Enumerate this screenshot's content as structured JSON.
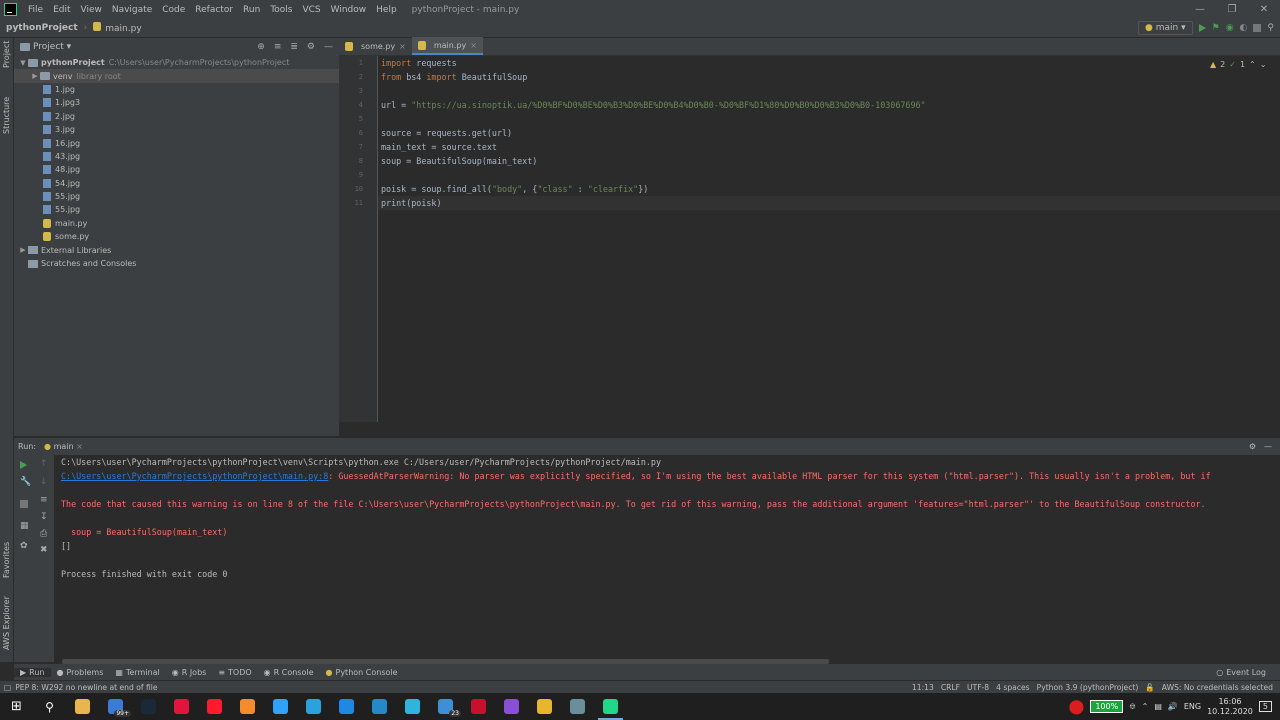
{
  "titlebar": {
    "menu": [
      "File",
      "Edit",
      "View",
      "Navigate",
      "Code",
      "Refactor",
      "Run",
      "Tools",
      "VCS",
      "Window",
      "Help"
    ],
    "window_title": "pythonProject - main.py"
  },
  "navbar": {
    "project": "pythonProject",
    "file": "main.py",
    "run_config": "main",
    "build_icon": "hammer-icon"
  },
  "sidebar": {
    "project_tab": "Project",
    "structure_tab": "Structure",
    "favorites_tab": "Favorites",
    "aws_tab": "AWS Explorer"
  },
  "project_panel": {
    "title": "Project",
    "root": {
      "name": "pythonProject",
      "path": "C:\\Users\\user\\PycharmProjects\\pythonProject"
    },
    "venv": {
      "name": "venv",
      "note": "library root"
    },
    "files": [
      "1.jpg",
      "1.jpg3",
      "2.jpg",
      "3.jpg",
      "16.jpg",
      "43.jpg",
      "48.jpg",
      "54.jpg",
      "55.jpg",
      "55.jpg"
    ],
    "py_files": [
      "main.py",
      "some.py"
    ],
    "external": "External Libraries",
    "scratches": "Scratches and Consoles"
  },
  "editor": {
    "tabs": [
      {
        "label": "some.py",
        "active": false
      },
      {
        "label": "main.py",
        "active": true
      }
    ],
    "line_numbers": [
      "1",
      "2",
      "3",
      "4",
      "5",
      "6",
      "7",
      "8",
      "9",
      "10",
      "11"
    ],
    "code": {
      "l1_kw": "import",
      "l1_rest": " requests",
      "l2_kw1": "from",
      "l2_mid": " bs4 ",
      "l2_kw2": "import",
      "l2_rest": " BeautifulSoup",
      "l4_pre": "url = ",
      "l4_url": "\"https://ua.sinoptik.ua/%D0%BF%D0%BE%D0%B3%D0%BE%D0%B4%D0%B0-%D0%BF%D1%80%D0%B0%D0%B3%D0%B0-103067696\"",
      "l6": "source = requests.get(url)",
      "l7": "main_text = source.text",
      "l8": "soup = BeautifulSoup(main_text)",
      "l10_pre": "poisk = soup.find_all(",
      "l10_s1": "\"body\"",
      "l10_mid": ", {",
      "l10_s2": "\"class\"",
      "l10_colon": " : ",
      "l10_s3": "\"clearfix\"",
      "l10_end": "})",
      "l11": "print(poisk)"
    },
    "inspections": {
      "warnings": "2",
      "ok": "1"
    }
  },
  "run_panel": {
    "label": "Run:",
    "tab": "main",
    "lines": {
      "cmd": "C:\\Users\\user\\PycharmProjects\\pythonProject\\venv\\Scripts\\python.exe C:/Users/user/PycharmProjects/pythonProject/main.py",
      "warn_link": "C:\\Users\\user\\PycharmProjects\\pythonProject\\main.py:8",
      "warn_text": ": GuessedAtParserWarning: No parser was explicitly specified, so I'm using the best available HTML parser for this system (\"html.parser\"). This usually isn't a problem, but if",
      "warn2": "The code that caused this warning is on line 8 of the file C:\\Users\\user\\PycharmProjects\\pythonProject\\main.py. To get rid of this warning, pass the additional argument 'features=\"html.parser\"' to the BeautifulSoup constructor.",
      "warn3": "  soup = BeautifulSoup(main_text)",
      "result": "[]",
      "finished": "Process finished with exit code 0"
    }
  },
  "bottom_tools": [
    {
      "label": "Run",
      "icon": "play-icon",
      "active": true
    },
    {
      "label": "Problems",
      "icon": "problems-icon",
      "active": false
    },
    {
      "label": "Terminal",
      "icon": "terminal-icon",
      "active": false
    },
    {
      "label": "R Jobs",
      "icon": "r-jobs-icon",
      "active": false
    },
    {
      "label": "TODO",
      "icon": "todo-icon",
      "active": false
    },
    {
      "label": "R Console",
      "icon": "r-console-icon",
      "active": false
    },
    {
      "label": "Python Console",
      "icon": "python-console-icon",
      "active": false
    }
  ],
  "event_log": "Event Log",
  "statusbar": {
    "message": "PEP 8: W292 no newline at end of file",
    "position": "11:13",
    "line_sep": "CRLF",
    "encoding": "UTF-8",
    "indent": "4 spaces",
    "interpreter": "Python 3.9 (pythonProject)",
    "aws": "AWS: No credentials selected"
  },
  "taskbar": {
    "apps": [
      {
        "name": "file-explorer-icon",
        "color": "#e8b64c"
      },
      {
        "name": "steam-badge-icon",
        "color": "#3a7bd5",
        "badge": "99+"
      },
      {
        "name": "steam-icon",
        "color": "#1b2838"
      },
      {
        "name": "opera-gx-icon",
        "color": "#e0143c"
      },
      {
        "name": "opera-icon",
        "color": "#ff1b2d"
      },
      {
        "name": "sublime-icon",
        "color": "#f58b2b"
      },
      {
        "name": "photoshop-icon",
        "color": "#2fa3f7"
      },
      {
        "name": "telegram-icon",
        "color": "#2aa3dc"
      },
      {
        "name": "outline-app-icon",
        "color": "#1e88e5"
      },
      {
        "name": "vscode-icon",
        "color": "#2489ca"
      },
      {
        "name": "edge-icon",
        "color": "#2fb4e0"
      },
      {
        "name": "notes-icon",
        "color": "#3f8fd6",
        "badge": "23"
      },
      {
        "name": "red-app-icon",
        "color": "#c8102e"
      },
      {
        "name": "purple-app-icon",
        "color": "#8a4fd8"
      },
      {
        "name": "chrome-icon",
        "color": "#e8b62d"
      },
      {
        "name": "app-green-icon",
        "color": "#6b8e9b"
      },
      {
        "name": "pycharm-icon",
        "color": "#21d789",
        "active": true
      }
    ],
    "battery": "100%",
    "lang": "ENG",
    "time": "16:06",
    "date": "10.12.2020",
    "notifications": "5"
  }
}
